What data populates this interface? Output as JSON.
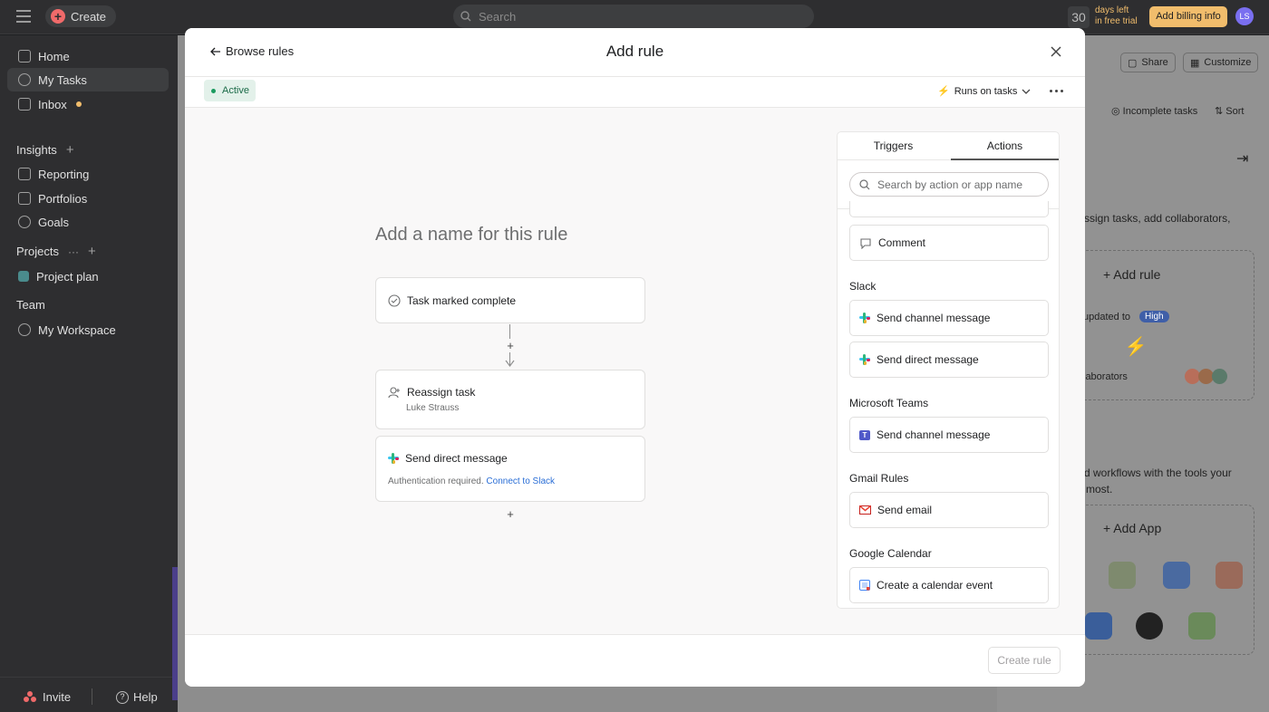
{
  "topbar": {
    "create_label": "Create",
    "search_placeholder": "Search",
    "trial_days": "30",
    "trial_line1": "days left",
    "trial_line2": "in free trial",
    "billing_label": "Add billing info",
    "avatar_initials": "LS"
  },
  "sidebar": {
    "home": "Home",
    "my_tasks": "My Tasks",
    "inbox": "Inbox",
    "insights": "Insights",
    "reporting": "Reporting",
    "portfolios": "Portfolios",
    "goals": "Goals",
    "projects": "Projects",
    "project_plan": "Project plan",
    "team": "Team",
    "my_workspace": "My Workspace",
    "invite": "Invite",
    "help": "Help"
  },
  "background_pane": {
    "share": "Share",
    "customize": "Customize",
    "incomplete_tasks": "Incomplete tasks",
    "sort": "Sort",
    "desc1": "ssign tasks, add collaborators,",
    "add_rule": "Add rule",
    "updated_to": "updated to",
    "high_badge": "High",
    "collaborators": "laborators",
    "desc2a": "d workflows with the tools your",
    "desc2b": "most.",
    "add_app": "Add App"
  },
  "modal": {
    "browse_rules": "Browse rules",
    "title": "Add rule",
    "status": "Active",
    "runs_on": "Runs on tasks",
    "name_placeholder": "Add a name for this rule",
    "trigger": "Task marked complete",
    "action1_title": "Reassign task",
    "action1_sub": "Luke Strauss",
    "action2_title": "Send direct message",
    "action2_auth": "Authentication required.",
    "action2_link": "Connect to Slack",
    "create_rule": "Create rule"
  },
  "panel": {
    "tab_triggers": "Triggers",
    "tab_actions": "Actions",
    "search_placeholder": "Search by action or app name",
    "comment": "Comment",
    "groups": {
      "slack": "Slack",
      "teams": "Microsoft Teams",
      "gmail": "Gmail Rules",
      "gcal": "Google Calendar"
    },
    "items": {
      "slack_channel": "Send channel message",
      "slack_direct": "Send direct message",
      "teams_channel": "Send channel message",
      "gmail_send": "Send email",
      "gcal_event": "Create a calendar event"
    }
  },
  "colors": {
    "accent_red": "#f06a6a",
    "active_green": "#1b6b48",
    "link_blue": "#2a6ed6",
    "billing_yellow": "#f1bd6c"
  }
}
